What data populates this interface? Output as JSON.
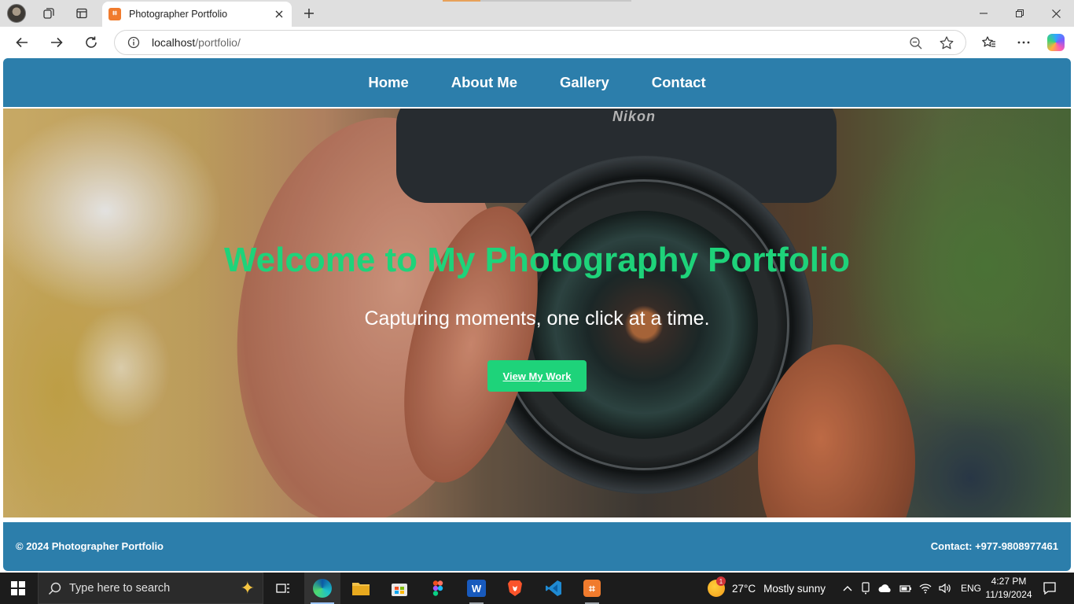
{
  "browser": {
    "tab_title": "Photographer Portfolio",
    "url_host": "localhost",
    "url_path": "/portfolio/"
  },
  "site": {
    "nav": [
      "Home",
      "About Me",
      "Gallery",
      "Contact"
    ],
    "hero": {
      "title": "Welcome to My Photography Portfolio",
      "subtitle": "Capturing moments, one click at a time.",
      "button": "View My Work",
      "camera_brand": "Nikon"
    },
    "footer": {
      "copyright": "© 2024 Photographer Portfolio",
      "contact": "Contact: +977-9808977461"
    },
    "colors": {
      "nav_bg": "#2c7eab",
      "accent_green": "#1ed37a"
    }
  },
  "taskbar": {
    "search_placeholder": "Type here to search",
    "weather_temp": "27°C",
    "weather_desc": "Mostly sunny",
    "weather_badge": "1",
    "language": "ENG",
    "time": "4:27 PM",
    "date": "11/19/2024",
    "apps": [
      "task-view-icon",
      "edge-icon",
      "file-explorer-icon",
      "store-icon",
      "figma-icon",
      "word-icon",
      "brave-icon",
      "vscode-icon",
      "xampp-icon"
    ]
  }
}
